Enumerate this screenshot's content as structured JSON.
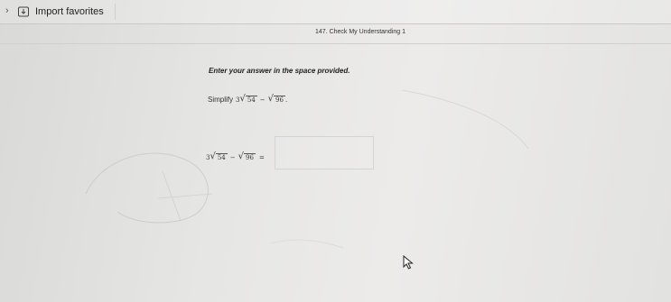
{
  "toolbar": {
    "import_label": "Import favorites",
    "icons": [
      "chevron-right-icon",
      "import-icon"
    ]
  },
  "question": {
    "header": "147. Check My Understanding 1",
    "instruction": "Enter your answer in the space provided.",
    "prompt_label": "Simplify",
    "prompt_coef": "3",
    "prompt_rad1": "54",
    "prompt_minus": "−",
    "prompt_rad2": "96",
    "prompt_end": ".",
    "answer_coef": "3",
    "answer_rad1": "54",
    "answer_minus": "−",
    "answer_rad2": "96",
    "answer_equals": "=",
    "answer_value": ""
  },
  "cursor": {
    "icon": "mouse-pointer-icon"
  }
}
